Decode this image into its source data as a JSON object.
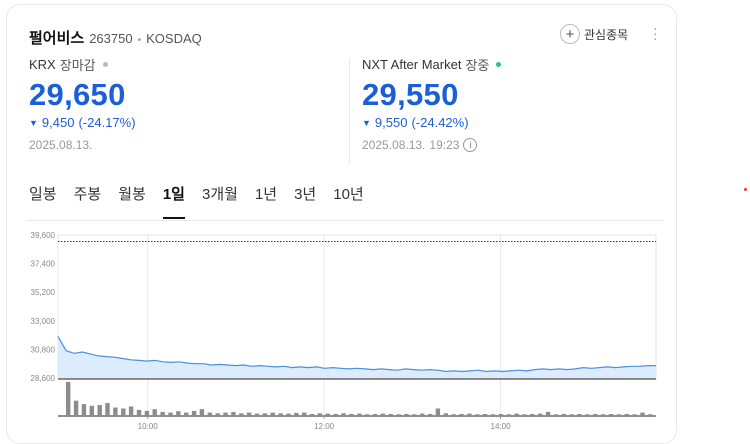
{
  "stock": {
    "name": "펄어비스",
    "code": "263750",
    "market": "KOSDAQ",
    "favorite_label": "관심종목",
    "more_icon": "⋮"
  },
  "krx": {
    "label": "KRX",
    "status": "장마감",
    "status_color": "#bbbbbb",
    "price": "29,650",
    "change": "9,450",
    "change_pct": "(-24.17%)",
    "date": "2025.08.13."
  },
  "nxt": {
    "label": "NXT After Market",
    "status": "장중",
    "status_color": "#2ec27e",
    "price": "29,550",
    "change": "9,550",
    "change_pct": "(-24.42%)",
    "date": "2025.08.13.",
    "time": "19:23"
  },
  "tabs": [
    "일봉",
    "주봉",
    "월봉",
    "1일",
    "3개월",
    "1년",
    "3년",
    "10년"
  ],
  "active_tab": "1일",
  "colors": {
    "accent_down": "#1a5fd8",
    "line": "#4a90e2",
    "area": "#dcebfd",
    "volume": "#8c8c8c"
  },
  "chart_data": {
    "type": "area",
    "ylim": [
      28600,
      39600
    ],
    "y_ticks": [
      "39,600",
      "37,400",
      "35,200",
      "33,000",
      "30,800",
      "28,600"
    ],
    "y_tick_values": [
      39600,
      37400,
      35200,
      33000,
      30800,
      28600
    ],
    "x_ticks": [
      "10:00",
      "12:00",
      "14:00"
    ],
    "x_tick_positions": [
      0.15,
      0.445,
      0.74
    ],
    "prev_close": 39100,
    "series": [
      {
        "values": [
          31800,
          30700,
          30500,
          30600,
          30450,
          30300,
          30250,
          30200,
          30100,
          30000,
          29950,
          29900,
          29950,
          29850,
          29800,
          29850,
          29750,
          29700,
          29700,
          29600,
          29650,
          29600,
          29550,
          29600,
          29500,
          29550,
          29500,
          29450,
          29500,
          29400,
          29450,
          29400,
          29450,
          29350,
          29400,
          29350,
          29300,
          29350,
          29300,
          29250,
          29300,
          29250,
          29200,
          29300,
          29250,
          29200,
          29250,
          29200,
          29100,
          29150,
          29100,
          29150,
          29200,
          29100,
          29150,
          29100,
          29150,
          29200,
          29150,
          29250,
          29300,
          29250,
          29300,
          29250,
          29300,
          29400,
          29350,
          29400,
          29450,
          29400,
          29450,
          29500,
          29500,
          29550,
          29550
        ]
      }
    ],
    "volume": [
      1.0,
      0.45,
      0.35,
      0.3,
      0.32,
      0.38,
      0.25,
      0.22,
      0.28,
      0.18,
      0.15,
      0.2,
      0.12,
      0.1,
      0.14,
      0.1,
      0.15,
      0.2,
      0.1,
      0.08,
      0.1,
      0.12,
      0.08,
      0.1,
      0.07,
      0.08,
      0.1,
      0.08,
      0.07,
      0.09,
      0.1,
      0.06,
      0.08,
      0.07,
      0.06,
      0.08,
      0.06,
      0.07,
      0.05,
      0.06,
      0.07,
      0.06,
      0.05,
      0.06,
      0.05,
      0.07,
      0.06,
      0.22,
      0.08,
      0.05,
      0.06,
      0.07,
      0.05,
      0.06,
      0.05,
      0.06,
      0.05,
      0.07,
      0.05,
      0.06,
      0.07,
      0.12,
      0.05,
      0.06,
      0.05,
      0.06,
      0.05,
      0.06,
      0.05,
      0.06,
      0.05,
      0.06,
      0.05,
      0.1,
      0.05
    ]
  }
}
